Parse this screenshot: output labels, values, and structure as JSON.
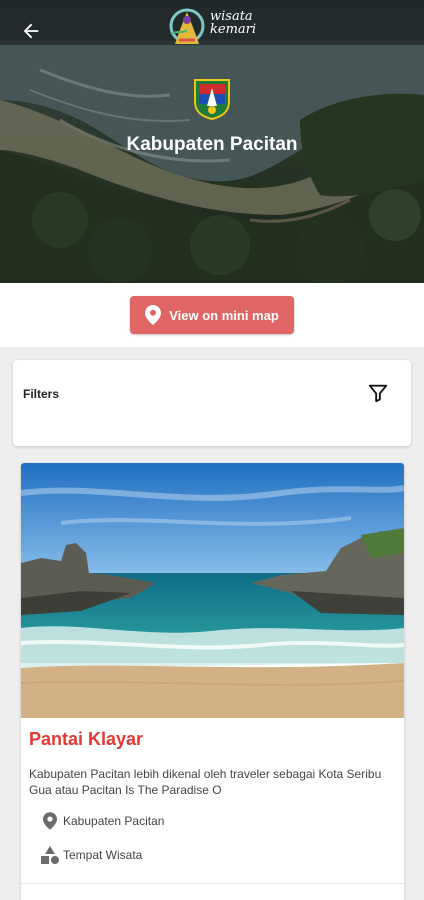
{
  "header": {
    "app_logo_text_1": "wisata",
    "app_logo_text_2": "kemari",
    "region_title": "Kabupaten Pacitan"
  },
  "map_button": {
    "label": "View on mini map",
    "color": "#e06666"
  },
  "filters": {
    "label": "Filters"
  },
  "places": [
    {
      "name": "Pantai Klayar",
      "description": "Kabupaten Pacitan lebih dikenal oleh traveler sebagai Kota Seribu Gua atau Pacitan Is The Paradise O",
      "region": "Kabupaten Pacitan",
      "category": "Tempat Wisata"
    }
  ],
  "colors": {
    "accent": "#e53935",
    "button": "#e06666"
  },
  "icons": [
    "back-arrow-icon",
    "location-pin-icon",
    "filter-icon",
    "category-shapes-icon"
  ]
}
